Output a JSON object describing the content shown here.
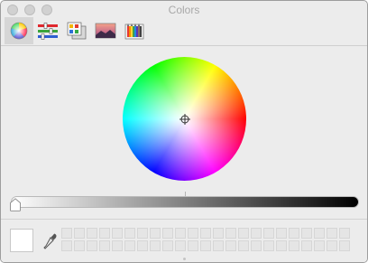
{
  "window": {
    "title": "Colors"
  },
  "toolbar": {
    "tabs": [
      {
        "name": "color-wheel",
        "icon": "color-wheel-icon",
        "selected": true
      },
      {
        "name": "color-sliders",
        "icon": "sliders-icon",
        "selected": false
      },
      {
        "name": "color-palettes",
        "icon": "palettes-icon",
        "selected": false
      },
      {
        "name": "image-palettes",
        "icon": "image-palette-icon",
        "selected": false
      },
      {
        "name": "pencils",
        "icon": "pencils-icon",
        "selected": false
      }
    ]
  },
  "brightness": {
    "value": 1.0
  },
  "current_color": "#ffffff",
  "swatches": {
    "rows": 2,
    "columns": 23
  }
}
